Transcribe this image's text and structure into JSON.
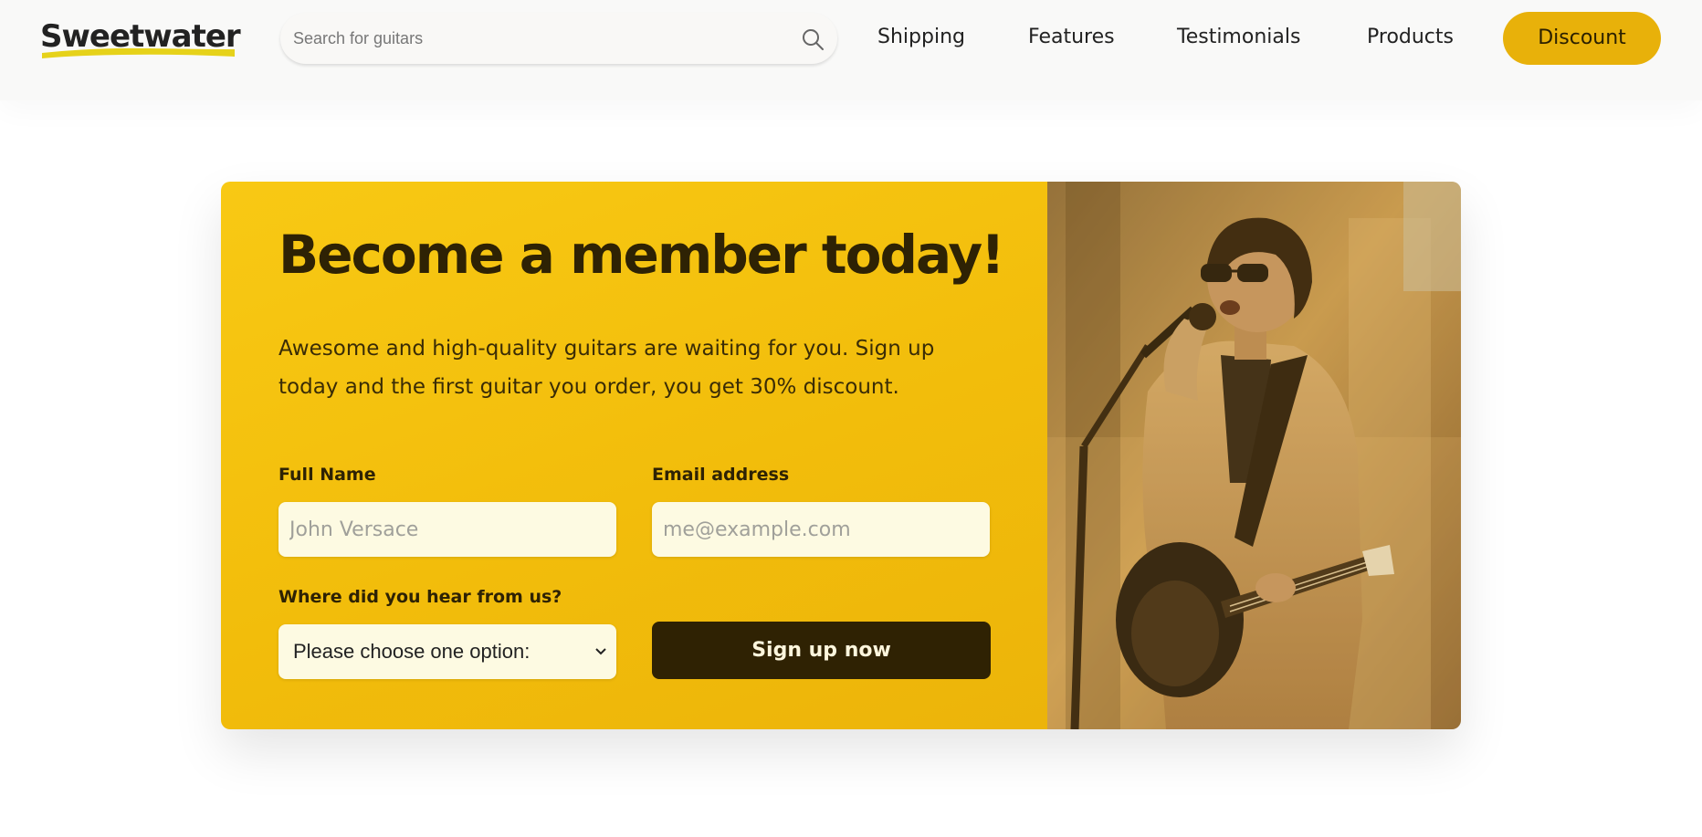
{
  "brand": {
    "name": "Sweetwater",
    "accent_color": "#e8b10a",
    "dark_color": "#2f2203"
  },
  "search": {
    "placeholder": "Search for guitars",
    "icon": "search-icon"
  },
  "nav": {
    "links": [
      "Shipping",
      "Features",
      "Testimonials",
      "Products"
    ],
    "cta_label": "Discount"
  },
  "hero": {
    "headline": "Become a member today!",
    "subtitle": "Awesome and high-quality guitars are waiting for you. Sign up today and the first guitar you order, you get 30% discount."
  },
  "form": {
    "full_name": {
      "label": "Full Name",
      "placeholder": "John Versace"
    },
    "email": {
      "label": "Email address",
      "placeholder": "me@example.com"
    },
    "source": {
      "label": "Where did you hear from us?",
      "selected": "Please choose one option:"
    },
    "submit_label": "Sign up now"
  },
  "image": {
    "subject": "guitarist-singing-photo"
  }
}
